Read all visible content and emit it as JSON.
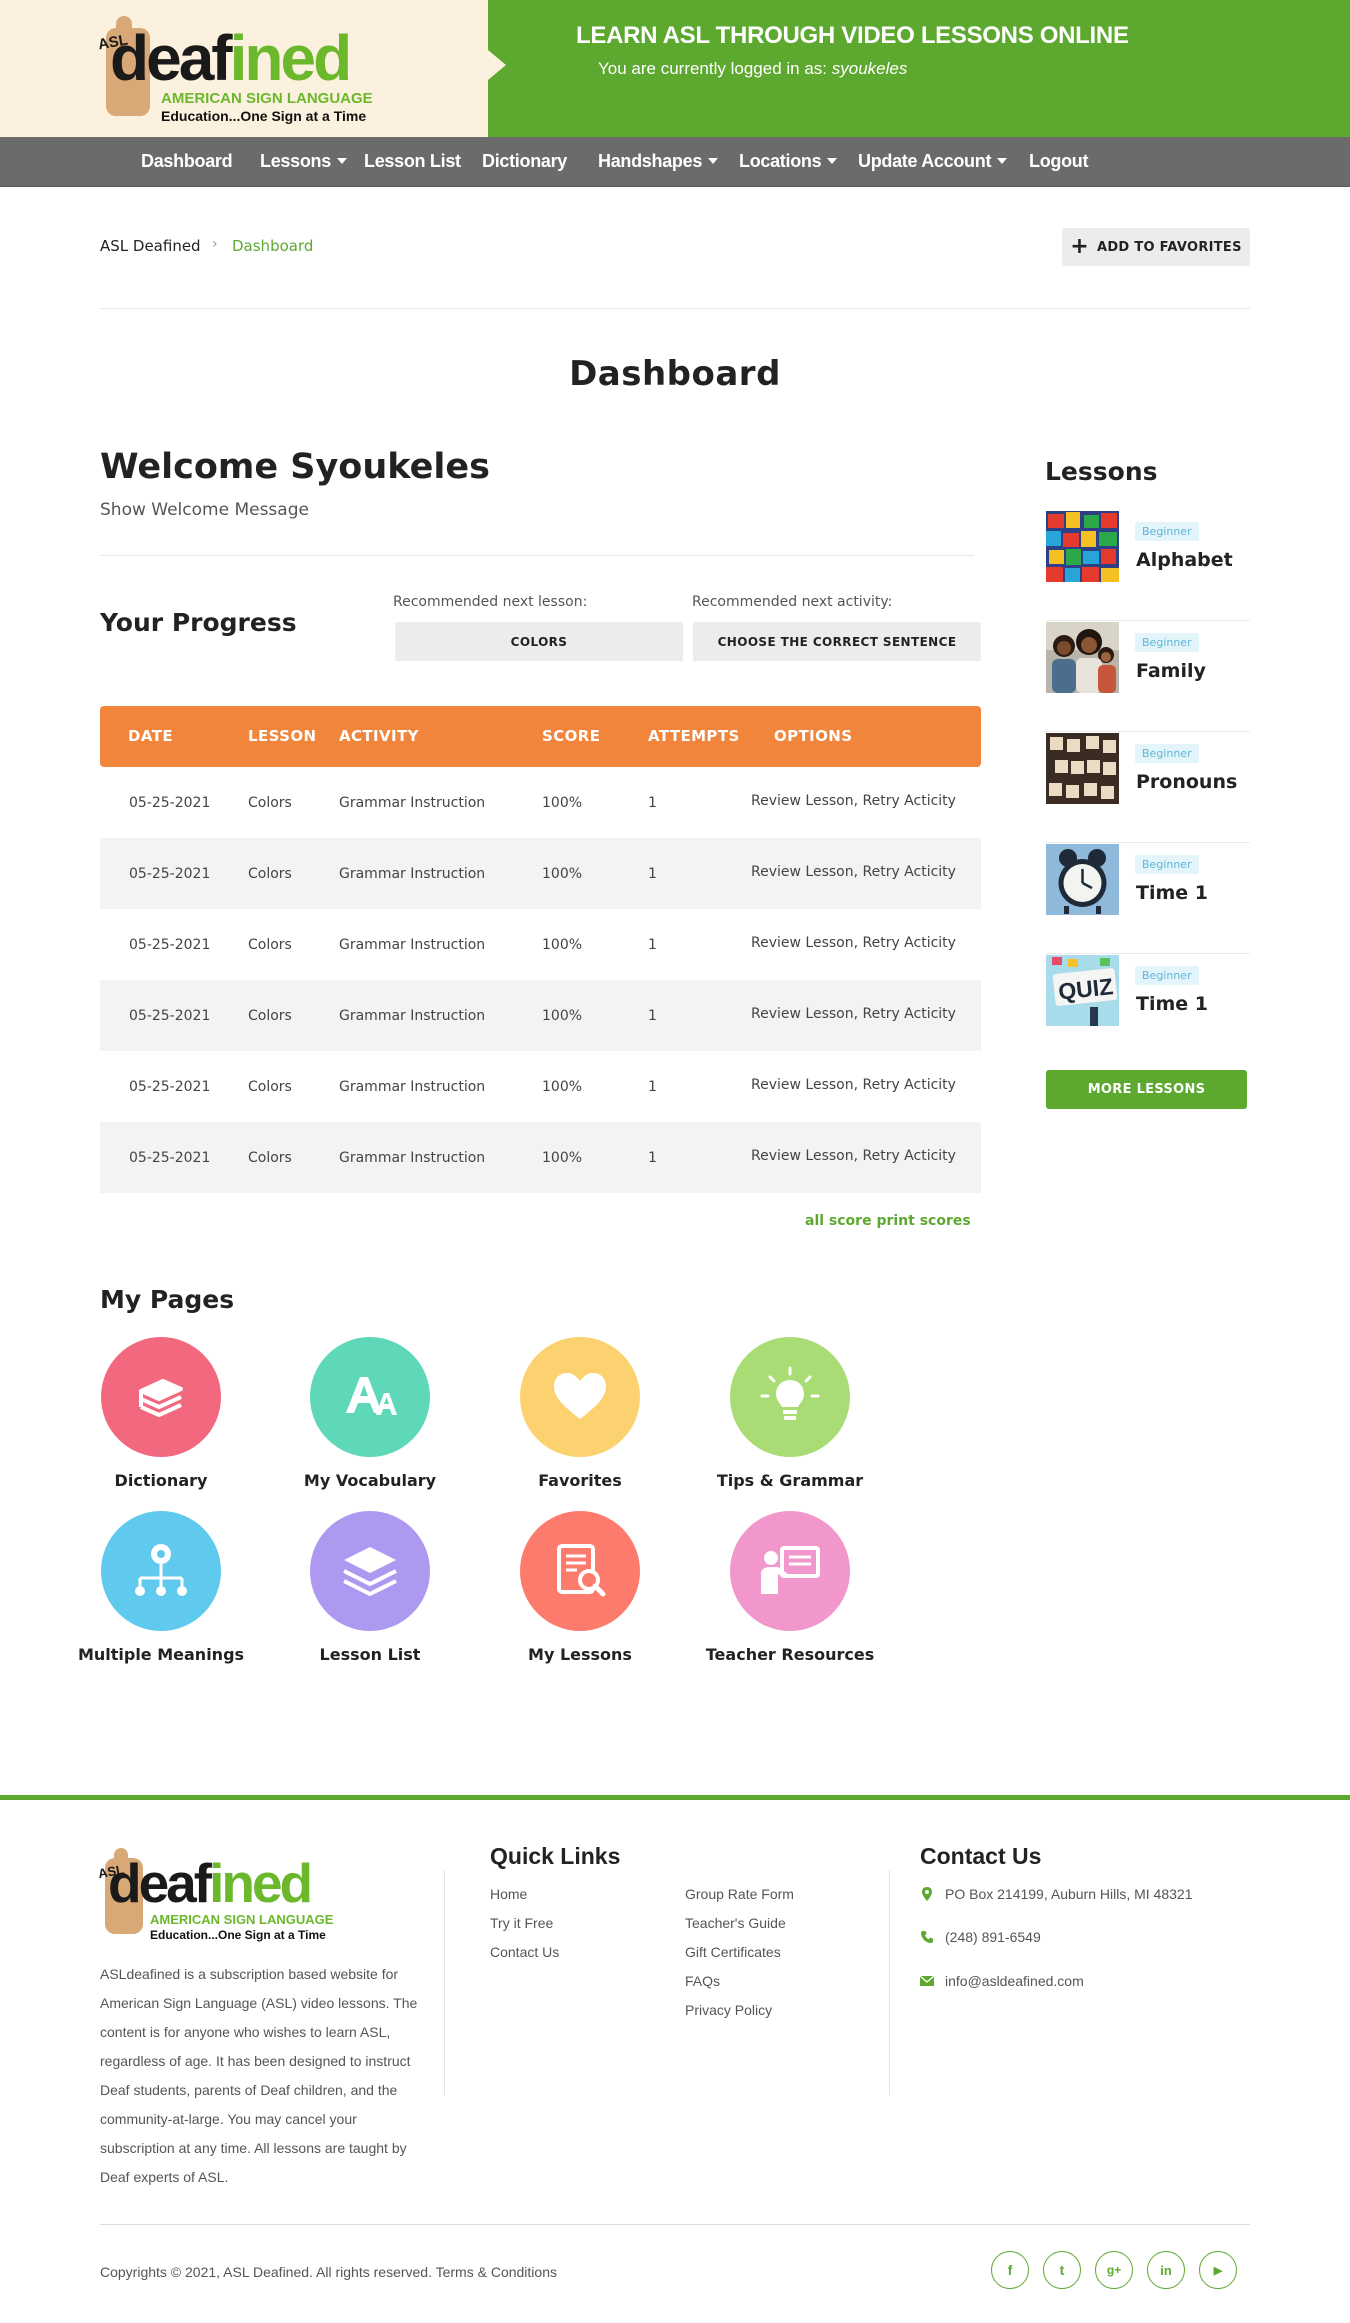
{
  "header": {
    "logo": {
      "asl": "ASL",
      "word_dark": "deaf",
      "word_green": "ined",
      "line1": "AMERICAN SIGN LANGUAGE",
      "line2": "Education...One Sign at a Time"
    },
    "tagline": "LEARN ASL THROUGH VIDEO LESSONS ONLINE",
    "login_prefix": "You are currently logged in as: ",
    "username": "syoukeles"
  },
  "nav": {
    "items": [
      {
        "label": "Dashboard",
        "dropdown": false
      },
      {
        "label": "Lessons",
        "dropdown": true
      },
      {
        "label": "Lesson List",
        "dropdown": false
      },
      {
        "label": "Dictionary",
        "dropdown": false
      },
      {
        "label": "Handshapes",
        "dropdown": true
      },
      {
        "label": "Locations",
        "dropdown": true
      },
      {
        "label": "Update Account",
        "dropdown": true
      },
      {
        "label": "Logout",
        "dropdown": false
      }
    ]
  },
  "breadcrumb": {
    "home": "ASL Deafined",
    "separator": "›",
    "current": "Dashboard"
  },
  "favorites_button": "ADD TO FAVORITES",
  "page_title": "Dashboard",
  "welcome": {
    "title": "Welcome Syoukeles",
    "toggle": "Show Welcome Message"
  },
  "progress": {
    "title": "Your Progress",
    "next_lesson_label": "Recommended next lesson:",
    "next_lesson": "COLORS",
    "next_activity_label": "Recommended next activity:",
    "next_activity": "CHOOSE THE CORRECT SENTENCE"
  },
  "table": {
    "headers": [
      "DATE",
      "LESSON",
      "ACTIVITY",
      "SCORE",
      "ATTEMPTS",
      "OPTIONS"
    ],
    "rows": [
      [
        "05-25-2021",
        "Colors",
        "Grammar Instruction",
        "100%",
        "1",
        "Review Lesson, Retry Acticity"
      ],
      [
        "05-25-2021",
        "Colors",
        "Grammar Instruction",
        "100%",
        "1",
        "Review Lesson, Retry Acticity"
      ],
      [
        "05-25-2021",
        "Colors",
        "Grammar Instruction",
        "100%",
        "1",
        "Review Lesson, Retry Acticity"
      ],
      [
        "05-25-2021",
        "Colors",
        "Grammar Instruction",
        "100%",
        "1",
        "Review Lesson, Retry Acticity"
      ],
      [
        "05-25-2021",
        "Colors",
        "Grammar Instruction",
        "100%",
        "1",
        "Review Lesson, Retry Acticity"
      ],
      [
        "05-25-2021",
        "Colors",
        "Grammar Instruction",
        "100%",
        "1",
        "Review Lesson, Retry Acticity"
      ]
    ],
    "print_link": "all score print scores"
  },
  "sidebar": {
    "title": "Lessons",
    "lessons": [
      {
        "level": "Beginner",
        "name": "Alphabet"
      },
      {
        "level": "Beginner",
        "name": "Family"
      },
      {
        "level": "Beginner",
        "name": "Pronouns"
      },
      {
        "level": "Beginner",
        "name": "Time 1"
      },
      {
        "level": "Beginner",
        "name": "Time 1"
      }
    ],
    "more_button": "MORE LESSONS",
    "quiz_text": "QUIZ"
  },
  "my_pages": {
    "title": "My Pages",
    "tiles": [
      {
        "label": "Dictionary",
        "icon": "books-icon",
        "color": "#f2687f"
      },
      {
        "label": "My Vocabulary",
        "icon": "letters-icon",
        "color": "#5fd8b9"
      },
      {
        "label": "Favorites",
        "icon": "heart-icon",
        "color": "#fbd26f"
      },
      {
        "label": "Tips & Grammar",
        "icon": "lightbulb-icon",
        "color": "#a9dc75"
      },
      {
        "label": "Multiple Meanings",
        "icon": "hierarchy-icon",
        "color": "#5fcaee"
      },
      {
        "label": "Lesson List",
        "icon": "layers-icon",
        "color": "#ad9af0"
      },
      {
        "label": "My Lessons",
        "icon": "document-search-icon",
        "color": "#fc7b6c"
      },
      {
        "label": "Teacher Resources",
        "icon": "teacher-board-icon",
        "color": "#f297cb"
      }
    ]
  },
  "footer": {
    "description": "ASLdeafined is a subscription based website for American Sign Language (ASL) video lessons. The content is for anyone who wishes to learn ASL, regardless of age. It has been designed to instruct Deaf students, parents of Deaf children, and the community-at-large. You may cancel your subscription at any time. All lessons are taught by Deaf experts of ASL.",
    "quick_links_title": "Quick Links",
    "links_col1": [
      "Home",
      "Try it Free",
      "Contact Us"
    ],
    "links_col2": [
      "Group Rate Form",
      "Teacher's Guide",
      "Gift Certificates",
      "FAQs",
      "Privacy Policy"
    ],
    "contact_title": "Contact Us",
    "address": "PO Box 214199, Auburn Hills, MI 48321",
    "phone": "(248) 891-6549",
    "email": "info@asldeafined.com",
    "copyright": "Copyrights © 2021, ASL Deafined. All rights reserved. Terms & Conditions",
    "social": [
      {
        "icon": "facebook-icon",
        "glyph": "f"
      },
      {
        "icon": "twitter-icon",
        "glyph": "t"
      },
      {
        "icon": "google-plus-icon",
        "glyph": "g+"
      },
      {
        "icon": "linkedin-icon",
        "glyph": "in"
      },
      {
        "icon": "youtube-icon",
        "glyph": "▶"
      }
    ]
  },
  "colors": {
    "brand_green": "#5da82f",
    "table_header_orange": "#f2853c",
    "nav_gray": "#6b6b6b",
    "header_cream": "#fbf1de"
  }
}
